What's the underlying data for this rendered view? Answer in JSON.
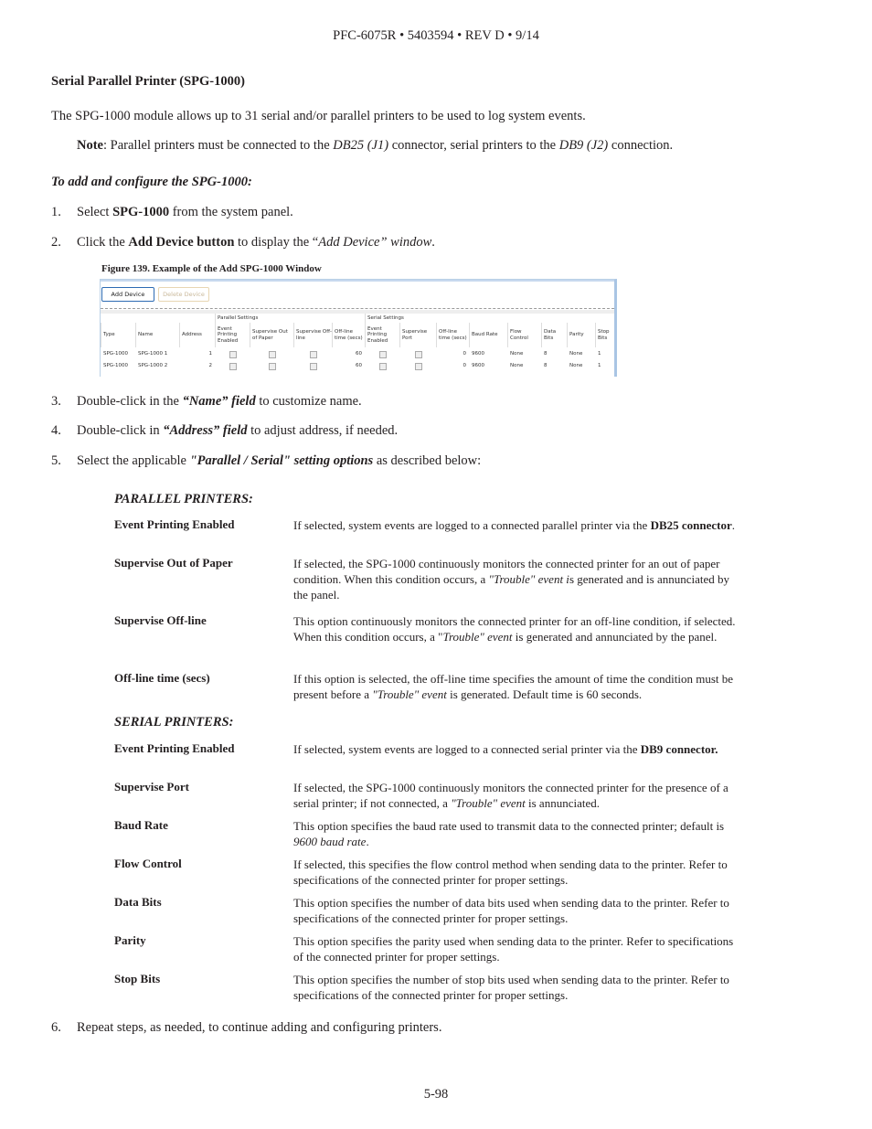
{
  "header": "PFC-6075R • 5403594 • REV D • 9/14",
  "section_title": "Serial Parallel Printer (SPG-1000)",
  "intro": "The SPG-1000 module allows up to 31 serial and/or parallel printers to be used to log system events.",
  "note": {
    "label": "Note",
    "t1": ": Parallel printers must be connected to the ",
    "i1": "DB25 (J1)",
    "t2": " connector, serial printers to the ",
    "i2": "DB9 (J2)",
    "t3": " connection."
  },
  "procedure_title": "To add and configure the SPG-1000:",
  "steps": [
    {
      "num": "1.",
      "a": "Select ",
      "b": "SPG-1000",
      "c": " from the system panel."
    },
    {
      "num": "2.",
      "a": "Click the ",
      "b": "Add Device button",
      "c": " to display the “",
      "d": "Add Device” window",
      "e": "."
    },
    {
      "num": "3.",
      "a": "Double-click in the ",
      "b": "“Name” field",
      "c": " to customize name."
    },
    {
      "num": "4.",
      "a": "Double-click in ",
      "b": "“Address” field",
      "c": " to adjust address, if needed."
    },
    {
      "num": "5.",
      "a": "Select the applicable ",
      "b": "\"Parallel / Serial\" setting options",
      "c": " as described below:"
    },
    {
      "num": "6.",
      "a": "Repeat steps, as needed, to continue adding and configuring printers."
    }
  ],
  "figure": {
    "caption": "Figure 139. Example of the Add SPG-1000 Window",
    "add_button": "Add Device",
    "delete_button": "Delete Device",
    "group_parallel": "Parallel Settings",
    "group_serial": "Serial Settings",
    "columns": [
      "Type",
      "Name",
      "Address",
      "Event Printing Enabled",
      "Supervise Out of Paper",
      "Supervise Off-line",
      "Off-line time (secs)",
      "Event Printing Enabled",
      "Supervise Port",
      "Off-line time (secs)",
      "Baud Rate",
      "Flow Control",
      "Data Bits",
      "Parity",
      "Stop Bits"
    ],
    "rows": [
      {
        "type": "SPG-1000",
        "name": "SPG-1000 1",
        "address": "1",
        "p_event": false,
        "p_paper": false,
        "p_offline": false,
        "p_time": "60",
        "s_event": false,
        "s_port": false,
        "s_time": "0",
        "baud": "9600",
        "flow": "None",
        "data_bits": "8",
        "parity": "None",
        "stop_bits": "1"
      },
      {
        "type": "SPG-1000",
        "name": "SPG-1000 2",
        "address": "2",
        "p_event": false,
        "p_paper": false,
        "p_offline": false,
        "p_time": "60",
        "s_event": false,
        "s_port": false,
        "s_time": "0",
        "baud": "9600",
        "flow": "None",
        "data_bits": "8",
        "parity": "None",
        "stop_bits": "1"
      }
    ]
  },
  "parallel": {
    "title": "PARALLEL PRINTERS:",
    "items": [
      {
        "term": "Event Printing Enabled",
        "d1": "If selected, system events are logged to a connected parallel printer via the ",
        "b": "DB25 connector",
        "d2": "."
      },
      {
        "term": "Supervise Out of Paper",
        "d1": "If selected, the SPG-1000 continuously monitors the connected printer for an out of paper condition. When this condition occurs, a ",
        "i": "\"Trouble\" event i",
        "d2": "s generated and is annunciated by the panel."
      },
      {
        "term": "Supervise Off-line",
        "d1": "This option continuously monitors the connected printer for an off-line condition, if selected. When this condition occurs, a \"",
        "i": "Trouble\" event",
        "d2": " is generated and annunciated by the panel."
      },
      {
        "term": "Off-line time (secs)",
        "d1": "If  this option is selected, the off-line time specifies the amount of time the condition must be present before a ",
        "i": "\"Trouble\" event",
        "d2": " is generated. Default time is 60 seconds."
      }
    ]
  },
  "serial": {
    "title": "SERIAL PRINTERS:",
    "items": [
      {
        "term": "Event Printing Enabled",
        "d1": "If selected, system events are logged to a connected serial printer via the ",
        "b": "DB9 connector.",
        "d2": ""
      },
      {
        "term": "Supervise Port",
        "d1": "If selected, the SPG-1000 continuously monitors the connected printer for the presence of a serial printer; if not connected, a ",
        "i": "\"Trouble\" event",
        "d2": " is annunciated."
      },
      {
        "term": "Baud Rate",
        "d1": "This option specifies the baud rate used to transmit data to the connected printer; default is ",
        "i": "9600 baud rate",
        "d2": "."
      },
      {
        "term": "Flow Control",
        "d1": "If selected, this specifies the flow control method when sending data to the printer. Refer to specifications of the connected printer for proper settings."
      },
      {
        "term": "Data Bits",
        "d1": "This option specifies the number of data bits used when sending data to the printer. Refer to specifications of the connected printer for proper settings."
      },
      {
        "term": "Parity",
        "d1": "This option specifies the parity used when sending data to the printer. Refer to specifications of the connected printer for proper settings."
      },
      {
        "term": "Stop Bits",
        "d1": "This option specifies the number of stop bits used when sending data to the printer. Refer to specifications of the connected printer for proper settings."
      }
    ]
  },
  "page_number": "5-98"
}
